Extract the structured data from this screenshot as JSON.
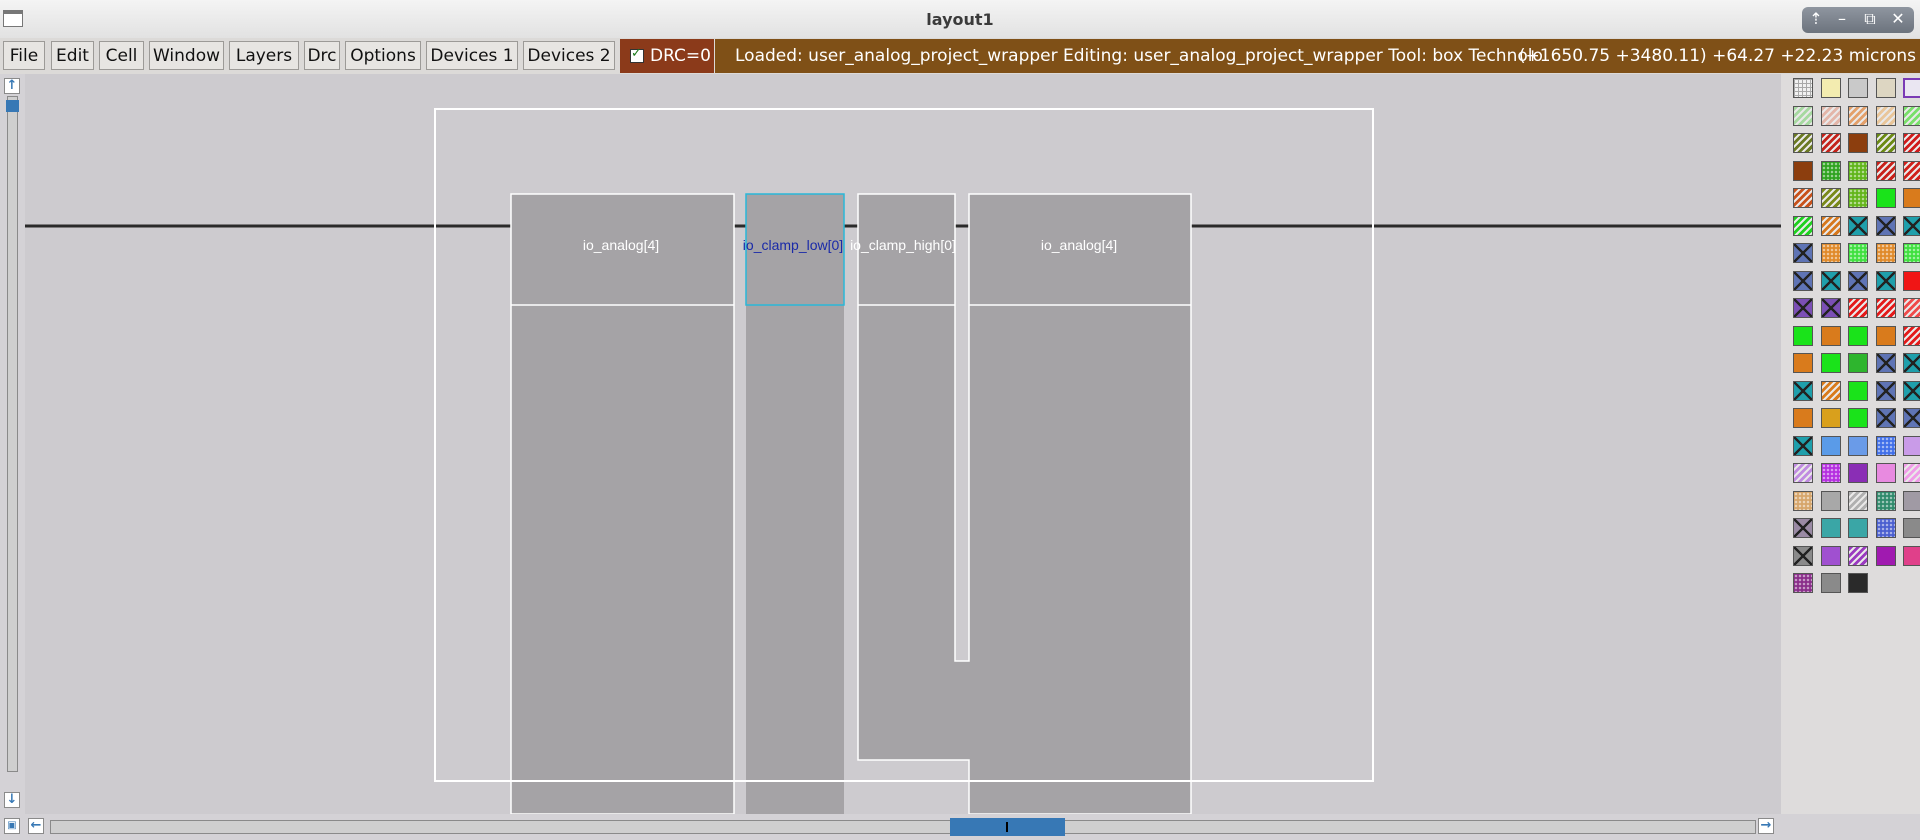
{
  "window": {
    "title": "layout1"
  },
  "menu": {
    "items": [
      "File",
      "Edit",
      "Cell",
      "Window",
      "Layers",
      "Drc",
      "Options",
      "Devices 1",
      "Devices 2"
    ]
  },
  "drc": {
    "label": "DRC=0",
    "checked": true
  },
  "status": {
    "text": "Loaded: user_analog_project_wrapper Editing: user_analog_project_wrapper Tool: box  Technolo",
    "coords": "(+1650.75 +3480.11) +64.27 +22.23 microns"
  },
  "layout": {
    "labels": [
      {
        "text": "io_analog[4]",
        "selected": false
      },
      {
        "text": "io_clamp_low[0]",
        "selected": true
      },
      {
        "text": "io_clamp_high[0]",
        "selected": false
      },
      {
        "text": "io_analog[4]",
        "selected": false
      }
    ]
  },
  "palette": {
    "rows": [
      [
        "grid-white",
        "solid-yellow-light",
        "solid-gray",
        "solid-beige",
        "outline-purple"
      ],
      [
        "hatch-green",
        "hatch-pink",
        "hatch-orange",
        "hatch-tan",
        "hatch-green-bright"
      ],
      [
        "hatch-olive",
        "hatch-red",
        "solid-brown",
        "hatch-olive2",
        "hatch-red2"
      ],
      [
        "solid-brown",
        "dots-green",
        "dots-green2",
        "hatch-red3",
        "hatch-red4"
      ],
      [
        "hatch-orange2",
        "hatch-olive3",
        "dots-green3",
        "solid-green",
        "solid-orange"
      ],
      [
        "hatch-green2",
        "hatch-orange3",
        "cross-teal",
        "cross-blue",
        "cross-teal2"
      ],
      [
        "cross-blue2",
        "dots-orange",
        "dots-green4",
        "dots-orange2",
        "dots-green5"
      ],
      [
        "cross-blue3",
        "cross-teal3",
        "cross-blue4",
        "cross-teal4",
        "solid-red"
      ],
      [
        "cross-purple",
        "cross-purple2",
        "hatch-red5",
        "hatch-red6",
        "hatch-red7"
      ],
      [
        "solid-green2",
        "solid-orange2",
        "solid-green3",
        "solid-orange3",
        "hatch-red8"
      ],
      [
        "solid-orange4",
        "solid-green4",
        "solid-green5",
        "cross-blue5",
        "cross-teal5"
      ],
      [
        "cross-teal6",
        "hatch-orange4",
        "solid-green6",
        "cross-blue6",
        "cross-teal7"
      ],
      [
        "solid-orange5",
        "solid-orange6",
        "solid-green7",
        "cross-blue7",
        "cross-blue8"
      ],
      [
        "cross-teal8",
        "solid-blue",
        "solid-blue2",
        "dots-blue",
        "solid-lavender"
      ],
      [
        "hatch-lavender",
        "dots-magenta",
        "solid-purple",
        "solid-pink",
        "hatch-pink2"
      ],
      [
        "dots-tan",
        "solid-gray2",
        "hatch-gray",
        "dots-teal",
        "solid-gray3"
      ],
      [
        "cross-gray",
        "solid-teal",
        "solid-teal2",
        "dots-blue2",
        "solid-gray4"
      ],
      [
        "cross-gray2",
        "solid-purple2",
        "hatch-purple",
        "solid-magenta",
        "solid-pink2"
      ],
      [
        "dots-purple",
        "solid-gray5",
        "solid-black"
      ]
    ],
    "colors": {
      "grid-white": "#f2f2f2",
      "solid-yellow-light": "#f3ecb0",
      "solid-gray": "#c9c9c9",
      "solid-beige": "#ddd6c2",
      "outline-purple": "#eae6f2",
      "hatch-green": "#a6d9a0",
      "hatch-pink": "#e3b6a9",
      "hatch-orange": "#e3a06b",
      "hatch-tan": "#e9c69a",
      "hatch-green-bright": "#79e06a",
      "hatch-olive": "#6b7a23",
      "hatch-red": "#c4231b",
      "solid-brown": "#8c3e0e",
      "hatch-olive2": "#6b8a14",
      "hatch-red2": "#d01a1a",
      "dots-green": "#2ea31f",
      "dots-green2": "#60b51a",
      "hatch-red3": "#c8211b",
      "hatch-red4": "#d0201b",
      "hatch-orange2": "#c8521b",
      "hatch-olive3": "#7a8a1a",
      "dots-green3": "#63b51a",
      "solid-green": "#1ae31a",
      "solid-orange": "#d97b1c",
      "hatch-green2": "#1fd11f",
      "hatch-orange3": "#d6781e",
      "cross-teal": "#1f9fab",
      "cross-blue": "#5f74b5",
      "cross-teal2": "#1f9fab",
      "cross-blue2": "#5f74b5",
      "dots-orange": "#e08a2a",
      "dots-green4": "#3fe03f",
      "dots-orange2": "#e08a2a",
      "dots-green5": "#3fe03f",
      "cross-blue3": "#5f74b5",
      "cross-teal3": "#1f9fab",
      "cross-blue4": "#5f74b5",
      "cross-teal4": "#1f9fab",
      "solid-red": "#f01515",
      "cross-purple": "#7b4fb5",
      "cross-purple2": "#7b4fb5",
      "hatch-red5": "#e41a1a",
      "hatch-red6": "#e41a1a",
      "hatch-red7": "#f04a4a",
      "solid-green2": "#1ae31a",
      "solid-orange2": "#d97b1c",
      "solid-green3": "#1ae31a",
      "solid-orange3": "#d97b1c",
      "hatch-red8": "#e41a1a",
      "solid-orange4": "#d97b1c",
      "solid-green4": "#1ae31a",
      "solid-green5": "#2eb52e",
      "cross-blue5": "#5f74b5",
      "cross-teal5": "#1f9fab",
      "cross-teal6": "#1f9fab",
      "hatch-orange4": "#d97b1c",
      "solid-green6": "#1ae31a",
      "cross-blue6": "#5f74b5",
      "cross-teal7": "#1f9fab",
      "solid-orange5": "#d97b1c",
      "solid-orange6": "#d9a01c",
      "solid-green7": "#1ae31a",
      "cross-blue7": "#5f74b5",
      "cross-blue8": "#5f74b5",
      "cross-teal8": "#1f9fab",
      "solid-blue": "#5a9be8",
      "solid-blue2": "#6a9be8",
      "dots-blue": "#3f6ee8",
      "solid-lavender": "#c99be8",
      "hatch-lavender": "#c08be0",
      "dots-magenta": "#b52ee0",
      "solid-purple": "#8a2eb5",
      "solid-pink": "#e88ae0",
      "hatch-pink2": "#f09be8",
      "dots-tan": "#d6a56b",
      "solid-gray2": "#a8a8a8",
      "hatch-gray": "#b0b0b0",
      "dots-teal": "#2e8a6b",
      "solid-gray3": "#a09aa4",
      "cross-gray": "#9a8aa4",
      "solid-teal": "#3aa6a6",
      "solid-teal2": "#3aa6a6",
      "dots-blue2": "#4a5fd0",
      "solid-gray4": "#8a8a8a",
      "cross-gray2": "#8a8a8a",
      "solid-purple2": "#a050d0",
      "hatch-purple": "#9a3ac0",
      "solid-magenta": "#a01ab0",
      "solid-pink2": "#e0408a",
      "dots-purple": "#8a2e8a",
      "solid-gray5": "#8a8a8a",
      "solid-black": "#2a2a2a"
    }
  },
  "colors": {
    "status_bg": "#7f5017",
    "drc_bg": "#8b3a1a",
    "canvas_bg": "#cdcbcf",
    "metal_fill": "#a5a3a6",
    "selection": "#2ab8d8"
  }
}
